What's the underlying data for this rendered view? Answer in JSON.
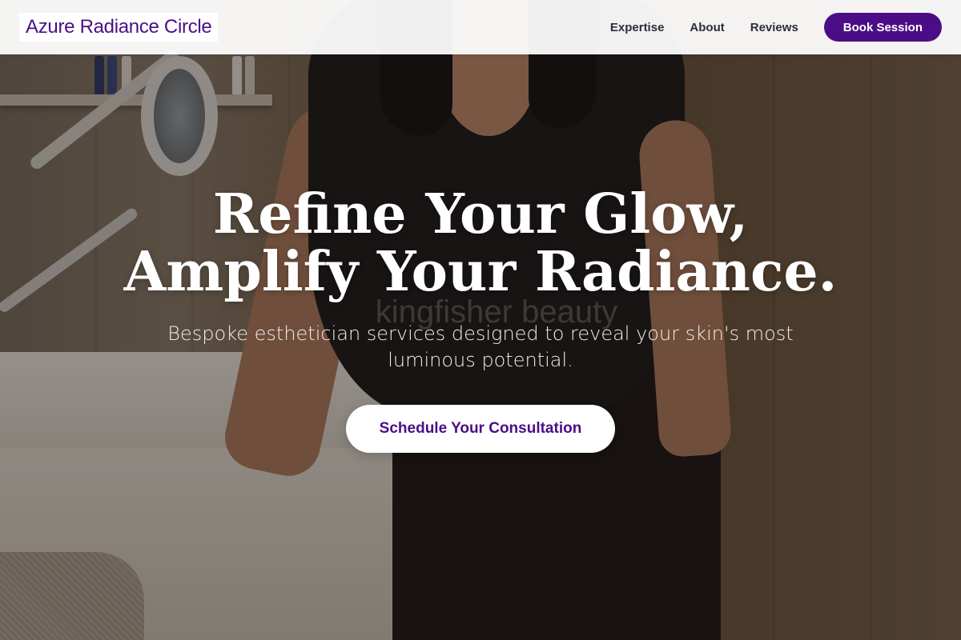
{
  "brand": {
    "name": "Azure Radiance Circle"
  },
  "nav": {
    "links": [
      "Expertise",
      "About",
      "Reviews"
    ],
    "cta": "Book Session"
  },
  "hero": {
    "headline_line1": "Refine Your Glow,",
    "headline_line2": "Amplify Your Radiance.",
    "subheadline": "Bespoke esthetician services designed to reveal your skin's most luminous potential.",
    "cta": "Schedule Your Consultation",
    "watermark": "kingfisher beauty"
  },
  "colors": {
    "accent": "#4b0d86",
    "navbar_bg": "#ffffff",
    "headline": "#ffffff"
  }
}
